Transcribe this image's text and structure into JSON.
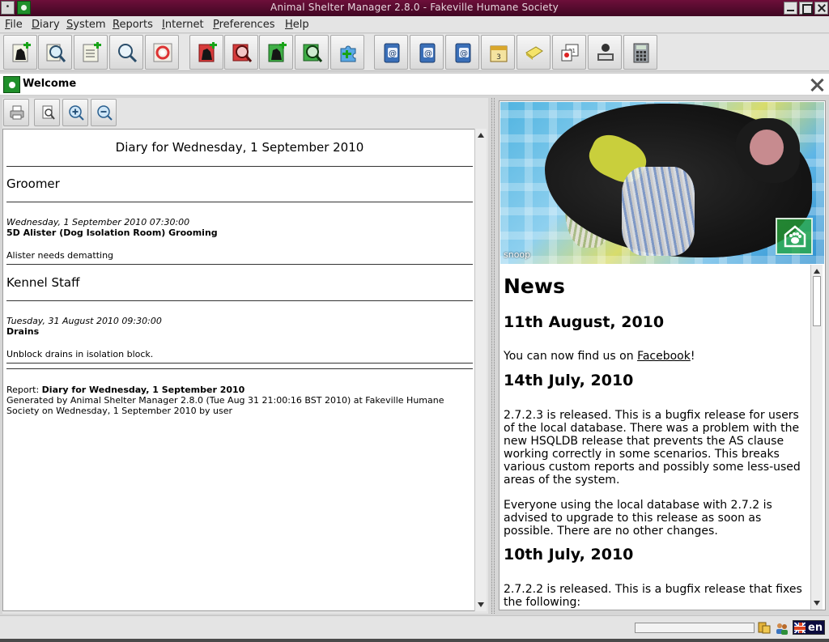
{
  "window": {
    "title": "Animal Shelter Manager 2.8.0 - Fakeville Humane Society",
    "menu_glyph": "•"
  },
  "menu": [
    "File",
    "Diary",
    "System",
    "Reports",
    "Internet",
    "Preferences",
    "Help"
  ],
  "toolbar": {
    "buttons": [
      {
        "icon": "add-animal-icon"
      },
      {
        "icon": "find-animal-icon"
      },
      {
        "icon": "add-person-icon"
      },
      {
        "icon": "find-person-icon"
      },
      {
        "icon": "lost-found-icon"
      },
      {
        "icon": "add-lost-animal-icon"
      },
      {
        "icon": "find-lost-animal-icon"
      },
      {
        "icon": "add-found-animal-icon"
      },
      {
        "icon": "find-found-animal-icon"
      },
      {
        "icon": "waiting-list-icon"
      },
      {
        "icon": "address-book-icon"
      },
      {
        "icon": "address-book-2-icon"
      },
      {
        "icon": "address-book-3-icon"
      },
      {
        "icon": "diary-calendar-icon"
      },
      {
        "icon": "note-icon"
      },
      {
        "icon": "calendar-page-icon"
      },
      {
        "icon": "vet-icon"
      },
      {
        "icon": "calculator-icon"
      }
    ]
  },
  "tab": {
    "title": "Welcome"
  },
  "report": {
    "title": "Diary for Wednesday, 1 September 2010",
    "sections": [
      {
        "heading": "Groomer",
        "date": "Wednesday, 1 September 2010 07:30:00",
        "subject": "5D Alister (Dog Isolation Room) Grooming",
        "note": "Alister needs dematting"
      },
      {
        "heading": "Kennel Staff",
        "date": "Tuesday, 31 August 2010 09:30:00",
        "subject": "Drains",
        "note": "Unblock drains in isolation block."
      }
    ],
    "footer_label": "Report: ",
    "footer_title": "Diary for Wednesday, 1 September 2010",
    "footer_line1": "Generated by Animal Shelter Manager 2.8.0 (Tue Aug 31 21:00:16 BST 2010) at Fakeville Humane",
    "footer_line2": "Society on Wednesday, 1 September 2010 by user"
  },
  "photo": {
    "caption": "snoop"
  },
  "news": {
    "title": "News",
    "items": [
      {
        "date": "11th August, 2010",
        "p1_pre": "You can now find us on ",
        "p1_link": "Facebook",
        "p1_post": "!"
      },
      {
        "date": "14th July, 2010",
        "p1": "2.7.2.3 is released. This is a bugfix release for users of the local database. There was a problem with the new HSQLDB release that prevents the AS clause working correctly in some scenarios. This breaks various custom reports and possibly some less-used areas of the system.",
        "p2": "Everyone using the local database with 2.7.2 is advised to upgrade to this release as soon as possible. There are no other changes."
      },
      {
        "date": "10th July, 2010",
        "p1": "2.7.2.2 is released. This is a bugfix release that fixes the following:"
      }
    ]
  },
  "status": {
    "language": "en"
  }
}
